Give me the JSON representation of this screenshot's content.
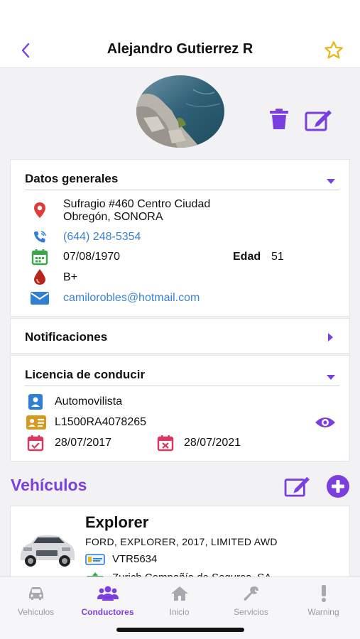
{
  "header": {
    "title": "Alejandro Gutierrez R"
  },
  "general": {
    "title": "Datos generales",
    "address_line1": "Sufragio #460 Centro Ciudad",
    "address_line2": "Obregón, SONORA",
    "phone": "(644) 248-5354",
    "birthdate": "07/08/1970",
    "age_label": "Edad",
    "age": "51",
    "blood_type": "B+",
    "email": "camilorobles@hotmail.com"
  },
  "notifications": {
    "title": "Notificaciones"
  },
  "license": {
    "title": "Licencia de conducir",
    "type": "Automovilista",
    "number": "L1500RA4078265",
    "issued": "28/07/2017",
    "expires": "28/07/2021"
  },
  "vehicles": {
    "title": "Vehículos",
    "items": [
      {
        "name": "Explorer",
        "details": "FORD, EXPLORER, 2017, LIMITED AWD",
        "plate": "VTR5634",
        "insurer": "Zurich Compañía de Seguros, SA"
      }
    ]
  },
  "tabs": [
    {
      "label": "Vehiculos",
      "icon": "car-icon",
      "active": false
    },
    {
      "label": "Conductores",
      "icon": "group-icon",
      "active": true
    },
    {
      "label": "Inicio",
      "icon": "home-icon",
      "active": false
    },
    {
      "label": "Servicios",
      "icon": "wrench-icon",
      "active": false
    },
    {
      "label": "Warning",
      "icon": "exclamation-icon",
      "active": false
    }
  ],
  "colors": {
    "accent": "#7b3fe0",
    "link": "#3a83d6",
    "star": "#e8b71c",
    "red": "#e23b3b",
    "green": "#3aa84a",
    "dark_red": "#b5261e",
    "blue": "#2f7fd3",
    "gold": "#d69a1e"
  }
}
